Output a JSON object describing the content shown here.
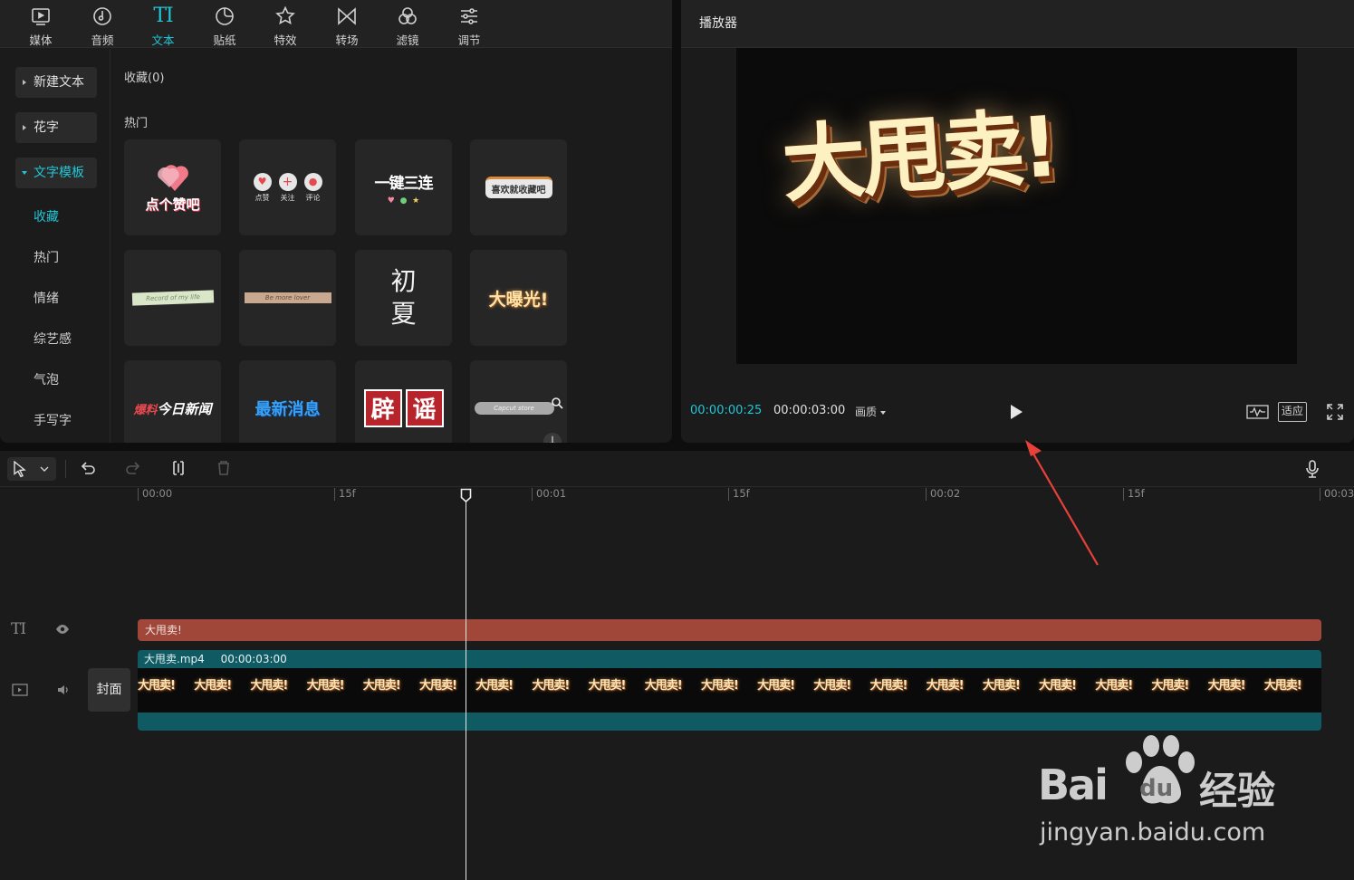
{
  "toolbar": {
    "tabs": [
      {
        "label": "媒体",
        "icon": "media-icon"
      },
      {
        "label": "音频",
        "icon": "audio-icon"
      },
      {
        "label": "文本",
        "icon": "text-icon",
        "active": true
      },
      {
        "label": "贴纸",
        "icon": "sticker-icon"
      },
      {
        "label": "特效",
        "icon": "effects-icon"
      },
      {
        "label": "转场",
        "icon": "transition-icon"
      },
      {
        "label": "滤镜",
        "icon": "filter-icon"
      },
      {
        "label": "调节",
        "icon": "adjust-icon"
      }
    ],
    "text_tab_glyph": "TI"
  },
  "sidebar": {
    "buttons": [
      {
        "label": "新建文本"
      },
      {
        "label": "花字"
      },
      {
        "label": "文字模板",
        "expanded": true
      }
    ],
    "sub_items": [
      "收藏",
      "热门",
      "情绪",
      "综艺感",
      "气泡",
      "手写字"
    ],
    "active_sub_item": "收藏"
  },
  "content": {
    "favorites_label": "收藏(0)",
    "hot_label": "热门",
    "templates": [
      {
        "text": "点个赞吧"
      },
      {
        "text": "点赞",
        "text2": "关注",
        "text3": "评论"
      },
      {
        "text": "一键三连"
      },
      {
        "text": "喜欢就收藏吧"
      },
      {
        "text": "Record of my life"
      },
      {
        "text": "Be more lover"
      },
      {
        "text": "初",
        "text2": "夏"
      },
      {
        "text": "大曝光!"
      },
      {
        "text": "今日新闻",
        "text2": "爆料"
      },
      {
        "text": "最新消息"
      },
      {
        "text": "辟",
        "text2": "谣"
      },
      {
        "text": "Capcut store"
      }
    ]
  },
  "player": {
    "title": "播放器",
    "video_text": "大甩卖!",
    "current_time": "00:00:00:25",
    "total_time": "00:00:03:00",
    "quality_label": "画质",
    "fit_label": "适应"
  },
  "timeline": {
    "ruler_labels": [
      "00:00",
      "15f",
      "00:01",
      "15f",
      "00:02",
      "15f",
      "00:03"
    ],
    "text_track_glyph": "TI",
    "text_clip_label": "大甩卖!",
    "video_clip_name": "大甩卖.mp4",
    "video_clip_duration": "00:00:03:00",
    "thumb_text": "大甩卖!",
    "cover_label": "封面"
  },
  "watermark": {
    "brand": "Bai",
    "brand2": "du",
    "cn": "经验",
    "url": "jingyan.baidu.com"
  },
  "colors": {
    "accent": "#20c7d6",
    "text_clip": "#a1473a",
    "video_clip": "#0f5a63",
    "arrow": "#e8413a"
  }
}
